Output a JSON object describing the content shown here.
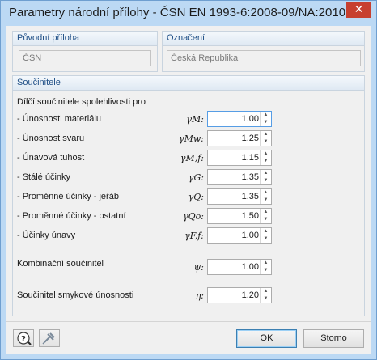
{
  "window": {
    "title": "Parametry národní přílohy - ČSN EN 1993-6:2008-09/NA:2010...",
    "close_glyph": "✕"
  },
  "puvodni": {
    "header": "Původní příloha",
    "value": "ČSN"
  },
  "oznaceni": {
    "header": "Označení",
    "value": "Česká Republika"
  },
  "soucinitele": {
    "header": "Součinitele",
    "subheader": "Dílčí součinitele spolehlivosti pro",
    "rows": [
      {
        "label": "- Únosnosti materiálu",
        "sym": "γ",
        "sub": "M:",
        "value": "1.00"
      },
      {
        "label": "- Únosnost svaru",
        "sym": "γ",
        "sub": "Mw:",
        "value": "1.25"
      },
      {
        "label": "- Únavová tuhost",
        "sym": "γ",
        "sub": "M,f:",
        "value": "1.15"
      },
      {
        "label": "- Stálé účinky",
        "sym": "γ",
        "sub": "G:",
        "value": "1.35"
      },
      {
        "label": "- Proměnné účinky - jeřáb",
        "sym": "γ",
        "sub": "Q:",
        "value": "1.35"
      },
      {
        "label": "- Proměnné účinky - ostatní",
        "sym": "γ",
        "sub": "Qo:",
        "value": "1.50"
      },
      {
        "label": "- Účinky únavy",
        "sym": "γ",
        "sub": "F,f:",
        "value": "1.00"
      }
    ],
    "kombinacni": {
      "label": "Kombinační součinitel",
      "sym": "ψ:",
      "value": "1.00"
    },
    "smykove": {
      "label": "Součinitel smykové únosnosti",
      "sym": "η:",
      "value": "1.20"
    }
  },
  "buttons": {
    "ok": "OK",
    "cancel": "Storno"
  },
  "icons": [
    "help-icon",
    "unpin-icon",
    "spin-up-icon",
    "spin-down-icon"
  ],
  "colors": {
    "title_bar": "#bcd9f4",
    "group_title": "#1f4f86",
    "close": "#c7402f"
  }
}
